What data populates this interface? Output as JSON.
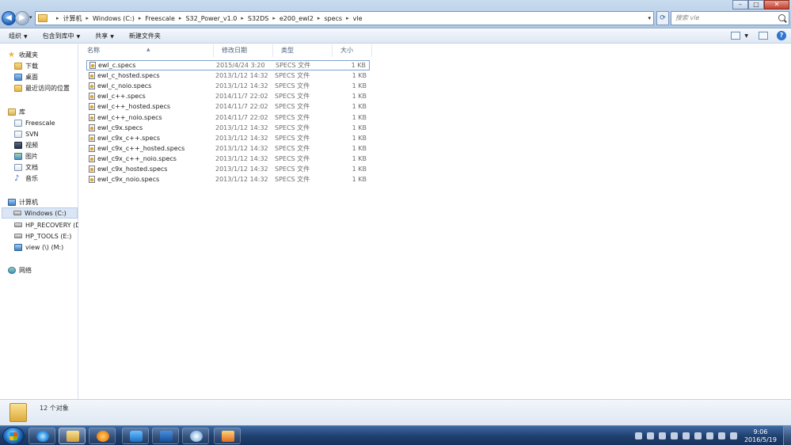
{
  "address": {
    "crumbs": [
      "计算机",
      "Windows (C:)",
      "Freescale",
      "S32_Power_v1.0",
      "S32DS",
      "e200_ewl2",
      "specs",
      "vle"
    ]
  },
  "search": {
    "placeholder": "搜索 vle"
  },
  "toolbar": {
    "organize": "组织",
    "include_library": "包含到库中",
    "share": "共享",
    "new_folder": "新建文件夹"
  },
  "nav": {
    "favorites": "收藏夹",
    "downloads": "下载",
    "desktop": "桌面",
    "recent": "最近访问的位置",
    "libraries": "库",
    "freescale": "Freescale",
    "svn": "SVN",
    "videos": "视频",
    "pictures": "图片",
    "documents": "文档",
    "music": "音乐",
    "computer": "计算机",
    "drive_c": "Windows (C:)",
    "drive_d": "HP_RECOVERY (D:)",
    "drive_e": "HP_TOOLS (E:)",
    "drive_m": "view (\\) (M:)",
    "network": "网络"
  },
  "columns": {
    "name": "名称",
    "date": "修改日期",
    "type": "类型",
    "size": "大小"
  },
  "files": [
    {
      "name": "ewl_c.specs",
      "date": "2015/4/24 3:20",
      "type": "SPECS 文件",
      "size": "1 KB"
    },
    {
      "name": "ewl_c_hosted.specs",
      "date": "2013/1/12 14:32",
      "type": "SPECS 文件",
      "size": "1 KB"
    },
    {
      "name": "ewl_c_noio.specs",
      "date": "2013/1/12 14:32",
      "type": "SPECS 文件",
      "size": "1 KB"
    },
    {
      "name": "ewl_c++.specs",
      "date": "2014/11/7 22:02",
      "type": "SPECS 文件",
      "size": "1 KB"
    },
    {
      "name": "ewl_c++_hosted.specs",
      "date": "2014/11/7 22:02",
      "type": "SPECS 文件",
      "size": "1 KB"
    },
    {
      "name": "ewl_c++_noio.specs",
      "date": "2014/11/7 22:02",
      "type": "SPECS 文件",
      "size": "1 KB"
    },
    {
      "name": "ewl_c9x.specs",
      "date": "2013/1/12 14:32",
      "type": "SPECS 文件",
      "size": "1 KB"
    },
    {
      "name": "ewl_c9x_c++.specs",
      "date": "2013/1/12 14:32",
      "type": "SPECS 文件",
      "size": "1 KB"
    },
    {
      "name": "ewl_c9x_c++_hosted.specs",
      "date": "2013/1/12 14:32",
      "type": "SPECS 文件",
      "size": "1 KB"
    },
    {
      "name": "ewl_c9x_c++_noio.specs",
      "date": "2013/1/12 14:32",
      "type": "SPECS 文件",
      "size": "1 KB"
    },
    {
      "name": "ewl_c9x_hosted.specs",
      "date": "2013/1/12 14:32",
      "type": "SPECS 文件",
      "size": "1 KB"
    },
    {
      "name": "ewl_c9x_noio.specs",
      "date": "2013/1/12 14:32",
      "type": "SPECS 文件",
      "size": "1 KB"
    }
  ],
  "details": {
    "count": "12 个对象"
  },
  "taskbar": {
    "apps": [
      "ie-icon",
      "explorer-icon",
      "media-player-icon",
      "qq-icon",
      "outlook-icon",
      "safari-icon",
      "matlab-icon"
    ],
    "time": "9:06",
    "date": "2016/5/19"
  },
  "colors": {
    "selection_border": "#7da2ce",
    "taskbar": "#1f3f6e",
    "accent": "#2f74d0"
  }
}
